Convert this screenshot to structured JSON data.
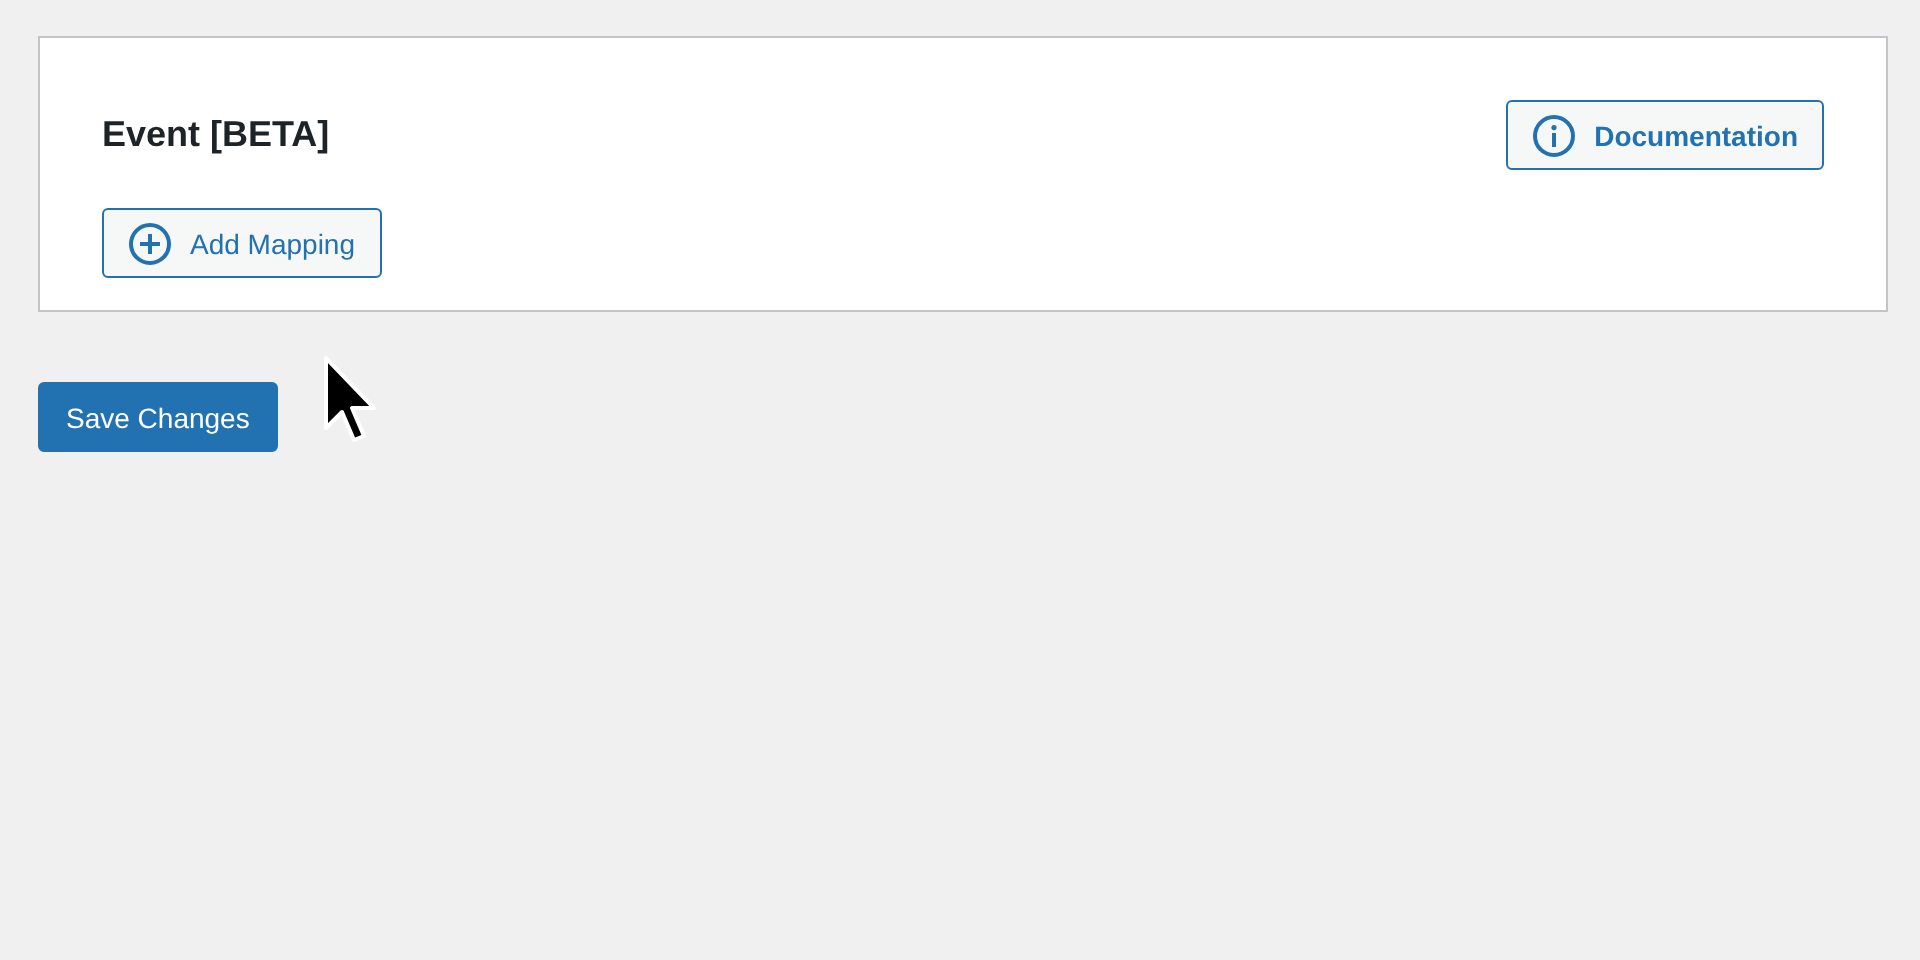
{
  "panel": {
    "title": "Event [BETA]",
    "documentation_button": "Documentation",
    "add_button": "Add Mapping"
  },
  "save_button": "Save Changes"
}
